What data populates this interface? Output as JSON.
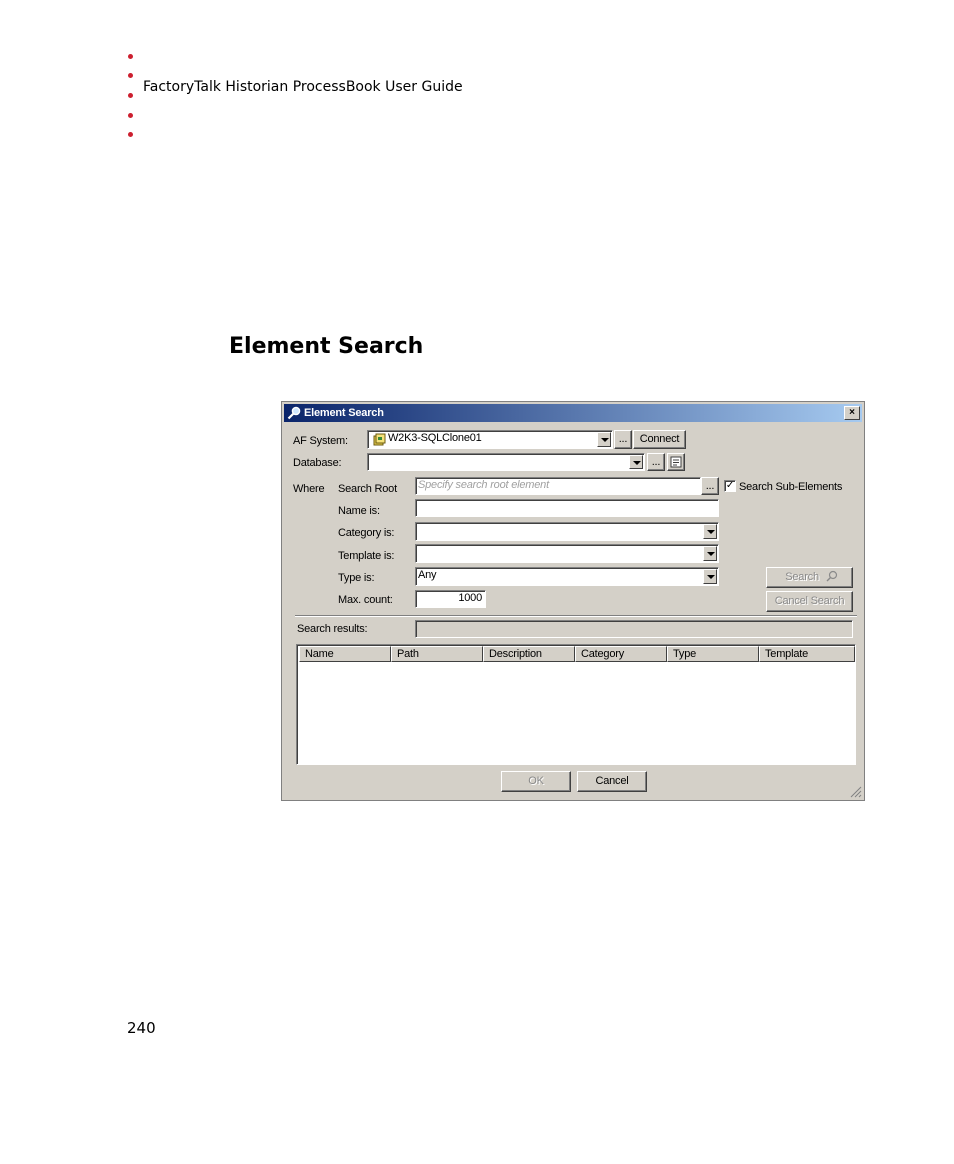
{
  "document": {
    "header_title": "FactoryTalk Historian ProcessBook User Guide",
    "section_title": "Element Search",
    "page_number": "240"
  },
  "dialog": {
    "title": "Element Search",
    "close_label": "×",
    "af_system_label": "AF System:",
    "af_system_value": "W2K3-SQLClone01",
    "browse_label": "...",
    "connect_label": "Connect",
    "database_label": "Database:",
    "database_value": "",
    "where_label": "Where",
    "search_root_label": "Search Root",
    "search_root_placeholder": "Specify search root element",
    "search_sub_elements_label": "Search Sub-Elements",
    "search_sub_elements_checked": true,
    "name_label": "Name is:",
    "name_value": "",
    "category_label": "Category is:",
    "category_value": "",
    "template_label": "Template is:",
    "template_value": "",
    "type_label": "Type is:",
    "type_value": "Any",
    "max_count_label": "Max. count:",
    "max_count_value": "1000",
    "search_label": "Search",
    "cancel_search_label": "Cancel Search",
    "search_results_label": "Search results:",
    "search_results_value": "",
    "columns": [
      "Name",
      "Path",
      "Description",
      "Category",
      "Type",
      "Template"
    ],
    "ok_label": "OK",
    "cancel_label": "Cancel"
  },
  "colors": {
    "bullet": "#cc1f2f",
    "dialog_face": "#d4d0c8",
    "titlebar_start": "#0a246a",
    "titlebar_end": "#a6caf0"
  },
  "icons": {
    "titlebar": "magnifier-icon",
    "af_system": "af-server-icon",
    "search": "search-icon",
    "database_properties": "properties-icon"
  }
}
